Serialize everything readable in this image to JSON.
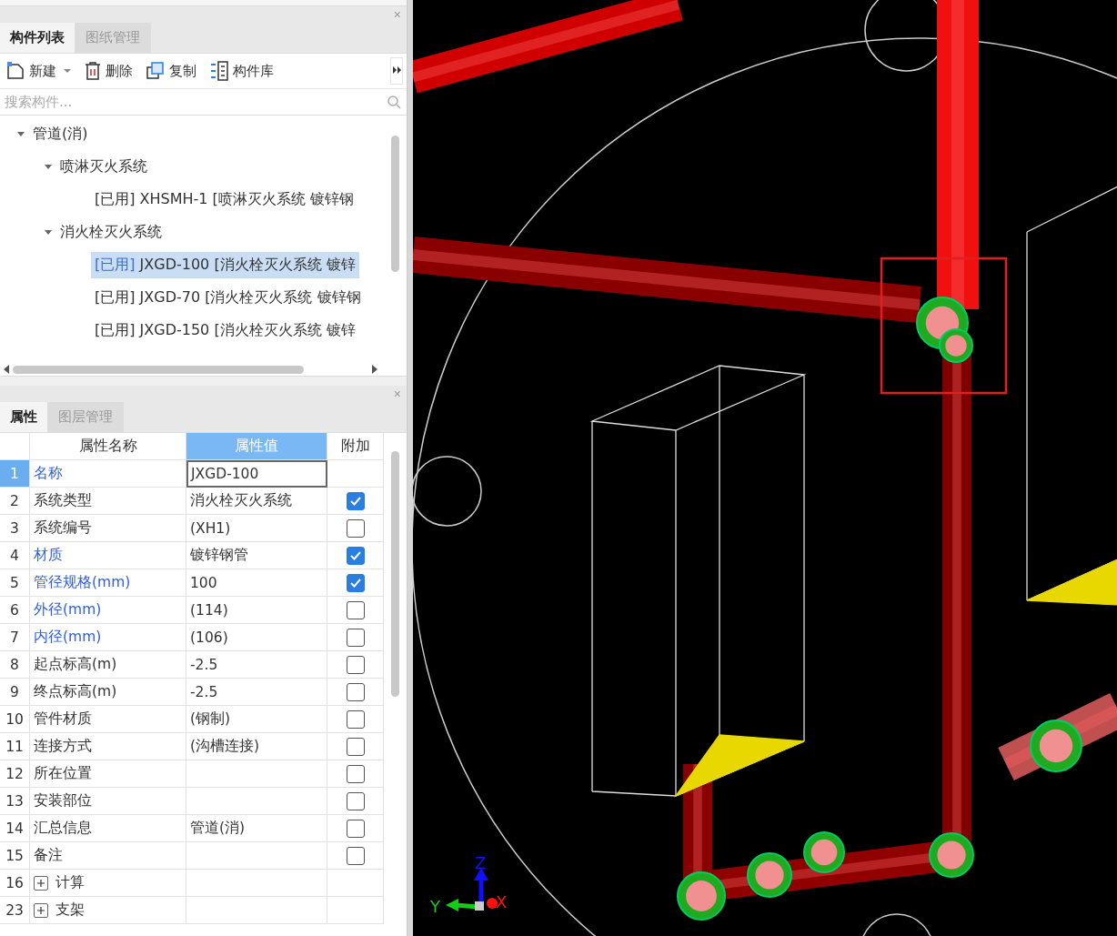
{
  "component_panel": {
    "close": "×",
    "tabs": [
      {
        "label": "构件列表",
        "selected": true
      },
      {
        "label": "图纸管理",
        "selected": false
      }
    ],
    "toolbar": [
      {
        "kind": "new",
        "label": "新建",
        "dropdown": true
      },
      {
        "kind": "delete",
        "label": "删除",
        "dropdown": false
      },
      {
        "kind": "copy",
        "label": "复制",
        "dropdown": false
      },
      {
        "kind": "library",
        "label": "构件库",
        "dropdown": false
      }
    ],
    "search": {
      "placeholder": "搜索构件..."
    },
    "tree": [
      {
        "label": "管道(消)",
        "expanded": true,
        "selected": false,
        "children": [
          {
            "label": "喷淋灭火系统",
            "expanded": true,
            "selected": false,
            "children": [
              {
                "tag": "[已用]",
                "label": "XHSMH-1 [喷淋灭火系统 镀锌钢",
                "selected": false
              }
            ]
          },
          {
            "label": "消火栓灭火系统",
            "expanded": true,
            "selected": false,
            "children": [
              {
                "tag": "[已用]",
                "label": "JXGD-100 [消火栓灭火系统 镀锌",
                "selected": true
              },
              {
                "tag": "[已用]",
                "label": "JXGD-70 [消火栓灭火系统 镀锌钢",
                "selected": false
              },
              {
                "tag": "[已用]",
                "label": "JXGD-150 [消火栓灭火系统 镀锌",
                "selected": false
              }
            ]
          }
        ]
      }
    ]
  },
  "property_panel": {
    "close": "×",
    "tabs": [
      {
        "label": "属性",
        "selected": true
      },
      {
        "label": "图层管理",
        "selected": false
      }
    ],
    "columns": [
      {
        "label": "属性名称",
        "selected": false
      },
      {
        "label": "属性值",
        "selected": true
      },
      {
        "label": "附加",
        "selected": false
      }
    ],
    "rows": [
      {
        "num": "1",
        "kind": "field",
        "name": "名称",
        "value": "JXGD-100",
        "public": true,
        "selected": true
      },
      {
        "num": "2",
        "kind": "field",
        "name": "系统类型",
        "value": "消火栓灭火系统",
        "public": false,
        "selected": false,
        "checked": true
      },
      {
        "num": "3",
        "kind": "field",
        "name": "系统编号",
        "value": "(XH1)",
        "public": false,
        "selected": false,
        "checked": false
      },
      {
        "num": "4",
        "kind": "field",
        "name": "材质",
        "value": "镀锌钢管",
        "public": true,
        "selected": false,
        "checked": true
      },
      {
        "num": "5",
        "kind": "field",
        "name": "管径规格(mm)",
        "value": "100",
        "public": true,
        "selected": false,
        "checked": true
      },
      {
        "num": "6",
        "kind": "field",
        "name": "外径(mm)",
        "value": "(114)",
        "public": true,
        "selected": false,
        "checked": false
      },
      {
        "num": "7",
        "kind": "field",
        "name": "内径(mm)",
        "value": "(106)",
        "public": true,
        "selected": false,
        "checked": false
      },
      {
        "num": "8",
        "kind": "field",
        "name": "起点标高(m)",
        "value": "-2.5",
        "public": false,
        "selected": false,
        "checked": false
      },
      {
        "num": "9",
        "kind": "field",
        "name": "终点标高(m)",
        "value": "-2.5",
        "public": false,
        "selected": false,
        "checked": false
      },
      {
        "num": "10",
        "kind": "field",
        "name": "管件材质",
        "value": "(钢制)",
        "public": false,
        "selected": false,
        "checked": false
      },
      {
        "num": "11",
        "kind": "field",
        "name": "连接方式",
        "value": "(沟槽连接)",
        "public": false,
        "selected": false,
        "checked": false
      },
      {
        "num": "12",
        "kind": "field",
        "name": "所在位置",
        "public": false,
        "selected": false,
        "checked": false
      },
      {
        "num": "13",
        "kind": "field",
        "name": "安装部位",
        "public": false,
        "selected": false,
        "checked": false
      },
      {
        "num": "14",
        "kind": "field",
        "name": "汇总信息",
        "value": "管道(消)",
        "public": false,
        "selected": false,
        "checked": false
      },
      {
        "num": "15",
        "kind": "field",
        "name": "备注",
        "public": false,
        "selected": false,
        "checked": false
      },
      {
        "num": "16",
        "kind": "group",
        "name": "计算",
        "selected": false
      },
      {
        "num": "23",
        "kind": "group",
        "name": "支架",
        "selected": false
      }
    ]
  },
  "viewport": {
    "axes": [
      {
        "label": "Z",
        "color": "#1010ff"
      },
      {
        "label": "Y",
        "color": "#10d010"
      },
      {
        "label": "X",
        "color": "#ff1010"
      }
    ]
  }
}
